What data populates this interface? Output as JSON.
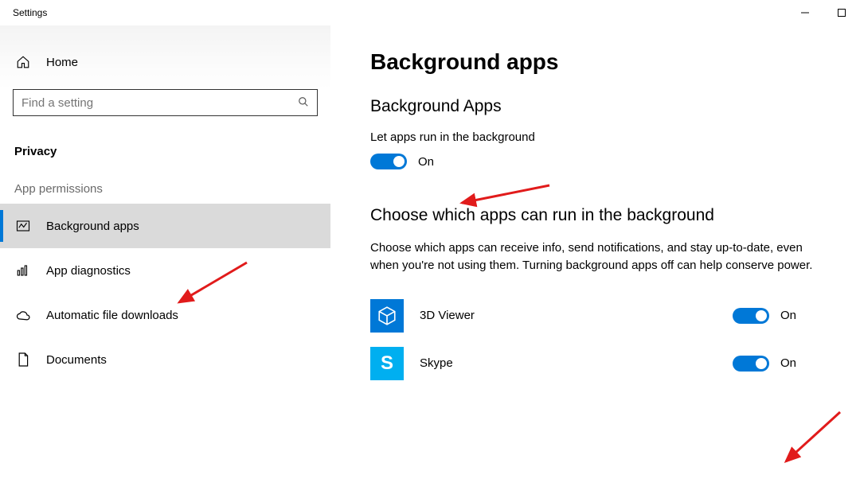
{
  "window": {
    "title": "Settings"
  },
  "sidebar": {
    "home_label": "Home",
    "search_placeholder": "Find a setting",
    "category": "Privacy",
    "section_label": "App permissions",
    "items": [
      {
        "label": "Background apps"
      },
      {
        "label": "App diagnostics"
      },
      {
        "label": "Automatic file downloads"
      },
      {
        "label": "Documents"
      }
    ]
  },
  "main": {
    "title": "Background apps",
    "section1_heading": "Background Apps",
    "master_toggle_label": "Let apps run in the background",
    "master_toggle_state": "On",
    "section2_heading": "Choose which apps can run in the background",
    "section2_desc": "Choose which apps can receive info, send notifications, and stay up-to-date, even when you're not using them. Turning background apps off can help conserve power.",
    "apps": [
      {
        "name": "3D Viewer",
        "state": "On",
        "icon": "cube-icon"
      },
      {
        "name": "Skype",
        "state": "On",
        "icon": "skype-icon"
      }
    ]
  },
  "colors": {
    "accent": "#0078d7",
    "arrow": "#e11b1b"
  }
}
